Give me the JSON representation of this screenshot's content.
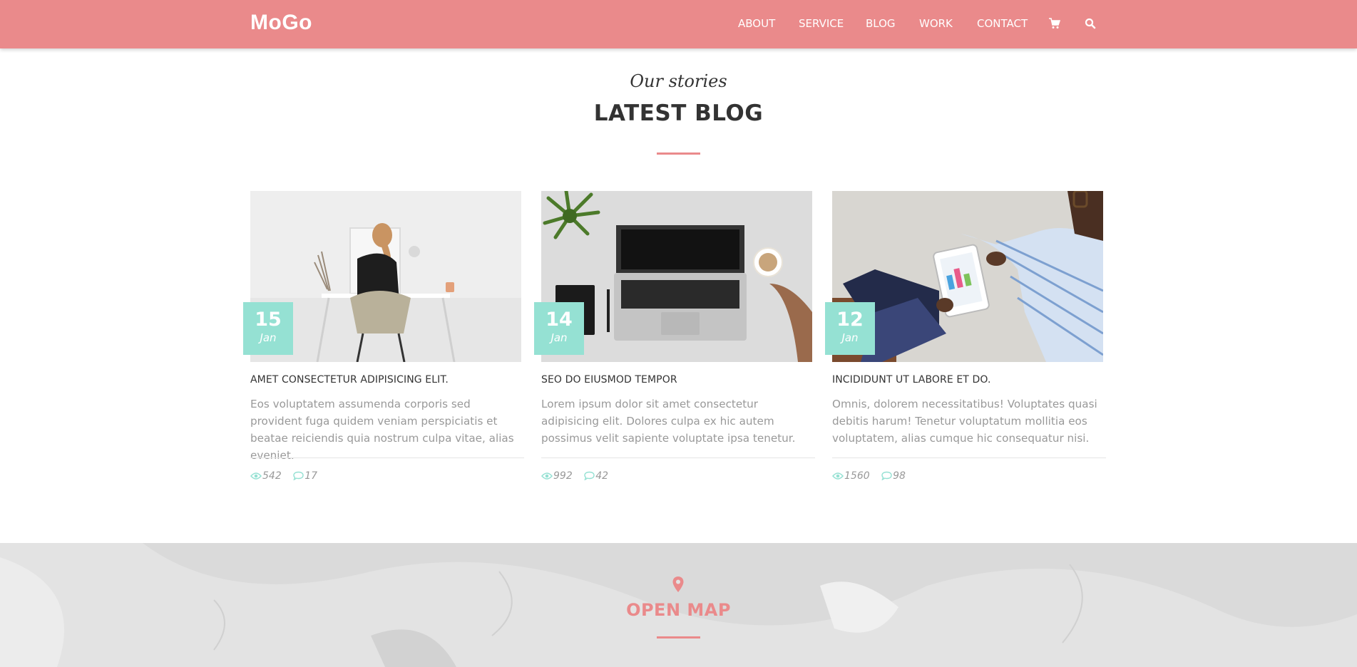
{
  "header": {
    "logo": "MoGo",
    "nav": [
      {
        "label": "ABOUT"
      },
      {
        "label": "SERVICE"
      },
      {
        "label": "BLOG"
      },
      {
        "label": "WORK"
      },
      {
        "label": "CONTACT"
      }
    ],
    "icons": [
      "cart-icon",
      "search-icon"
    ]
  },
  "section": {
    "subtitle": "Our stories",
    "title": "LATEST BLOG"
  },
  "posts": [
    {
      "day": "15",
      "month": "Jan",
      "title": "AMET CONSECTETUR ADIPISICING ELIT.",
      "text": "Eos voluptatem assumenda corporis sed provident fuga quidem veniam perspiciatis et beatae reiciendis quia nostrum culpa vitae, alias eveniet.",
      "views": "542",
      "comments": "17"
    },
    {
      "day": "14",
      "month": "Jan",
      "title": "SEO DO EIUSMOD TEMPOR",
      "text": "Lorem ipsum dolor sit amet consectetur adipisicing elit. Dolores culpa ex hic autem possimus velit sapiente voluptate ipsa tenetur.",
      "views": "992",
      "comments": "42"
    },
    {
      "day": "12",
      "month": "Jan",
      "title": "INCIDIDUNT UT LABORE ET DO.",
      "text": "Omnis, dolorem necessitatibus! Voluptates quasi debitis harum! Tenetur voluptatum mollitia eos voluptatem, alias cumque hic consequatur nisi.",
      "views": "1560",
      "comments": "98"
    }
  ],
  "map": {
    "title": "OPEN MAP"
  },
  "colors": {
    "accent": "#ea8a8b",
    "badge": "#95e1d3",
    "text": "#333333",
    "muted": "#999999"
  }
}
